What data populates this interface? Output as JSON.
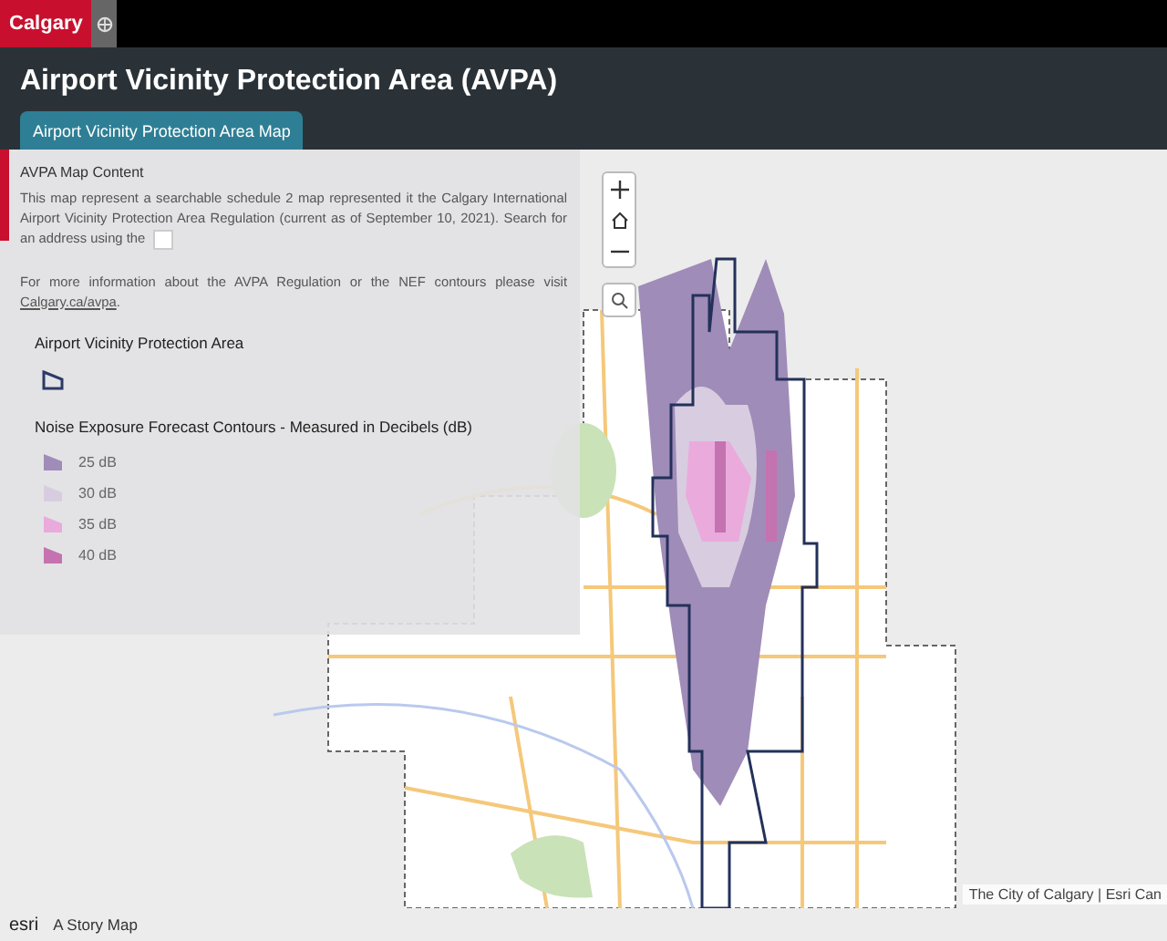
{
  "brand": {
    "logo": "Calgary"
  },
  "header": {
    "title": "Airport Vicinity Protection Area (AVPA)"
  },
  "tabs": [
    {
      "label": "Airport Vicinity Protection Area Map",
      "selected": true
    }
  ],
  "panel": {
    "heading": "AVPA Map Content",
    "intro": "This map represent a searchable schedule 2 map represented it the Calgary International Airport Vicinity Protection Area Regulation (current as of September 10, 2021). Search for an address using the",
    "more_info": "For more information about the AVPA Regulation or the NEF contours please visit",
    "link": "Calgary.ca/avpa",
    "link_after": "."
  },
  "legend": {
    "boundary_title": "Airport Vicinity Protection Area",
    "contours_title": "Noise Exposure Forecast Contours - Measured in Decibels (dB)",
    "contours": [
      {
        "label": "25 dB",
        "color": "#a08cb8"
      },
      {
        "label": "30 dB",
        "color": "#d8cde0"
      },
      {
        "label": "35 dB",
        "color": "#eaaadc"
      },
      {
        "label": "40 dB",
        "color": "#c472b0"
      }
    ]
  },
  "map": {
    "attribution": "The City of Calgary | Esri Can"
  },
  "footer": {
    "brand": "esri",
    "label": "A Story Map"
  }
}
